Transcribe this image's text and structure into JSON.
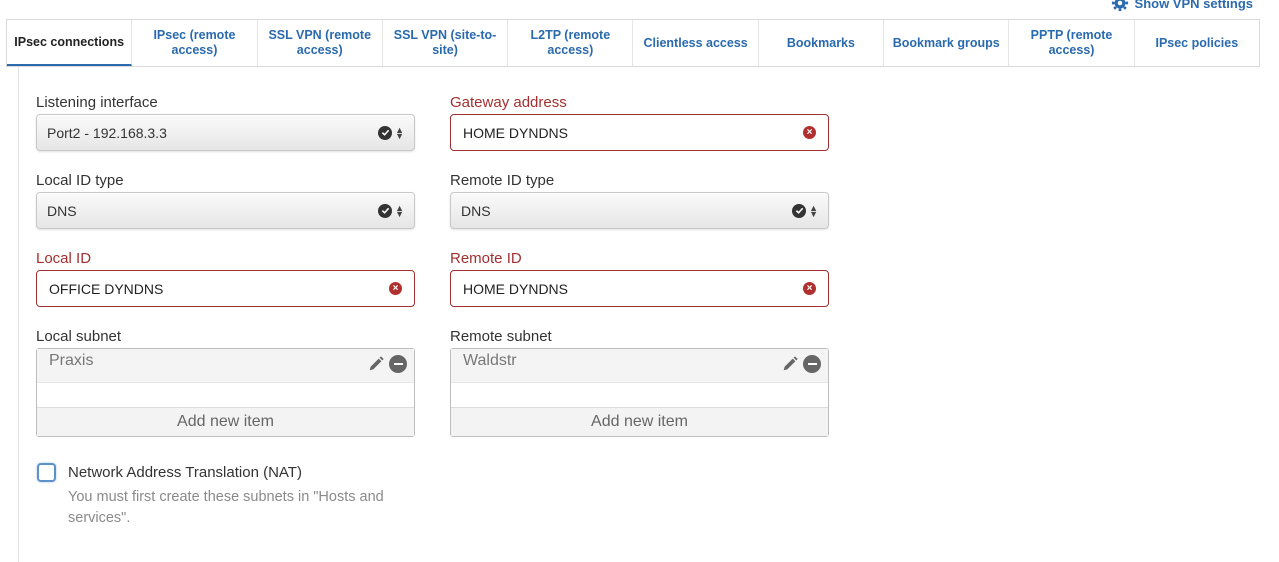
{
  "header": {
    "show_settings_label": "Show VPN settings"
  },
  "tabs": [
    {
      "label": "IPsec connections",
      "active": true
    },
    {
      "label": "IPsec (remote access)"
    },
    {
      "label": "SSL VPN (remote access)"
    },
    {
      "label": "SSL VPN (site-to-site)"
    },
    {
      "label": "L2TP (remote access)"
    },
    {
      "label": "Clientless access"
    },
    {
      "label": "Bookmarks"
    },
    {
      "label": "Bookmark groups"
    },
    {
      "label": "PPTP (remote access)"
    },
    {
      "label": "IPsec policies"
    }
  ],
  "form": {
    "listening_interface": {
      "label": "Listening interface",
      "value": "Port2 - 192.168.3.3"
    },
    "gateway_address": {
      "label": "Gateway address",
      "value": "HOME DYNDNS"
    },
    "local_id_type": {
      "label": "Local ID type",
      "value": "DNS"
    },
    "remote_id_type": {
      "label": "Remote ID type",
      "value": "DNS"
    },
    "local_id": {
      "label": "Local ID",
      "value": "OFFICE DYNDNS"
    },
    "remote_id": {
      "label": "Remote ID",
      "value": "HOME DYNDNS"
    },
    "local_subnet": {
      "label": "Local subnet",
      "items": [
        "Praxis"
      ],
      "add_label": "Add new item"
    },
    "remote_subnet": {
      "label": "Remote subnet",
      "items": [
        "Waldstr"
      ],
      "add_label": "Add new item"
    },
    "nat": {
      "label": "Network Address Translation (NAT)",
      "checked": false,
      "hint": "You must first create these subnets in \"Hosts and services\"."
    }
  },
  "colors": {
    "accent": "#2a6aad",
    "error": "#a33030"
  },
  "icons": [
    "gear-icon",
    "check-circle-icon",
    "updown-arrows-icon",
    "clear-icon",
    "pencil-icon",
    "remove-icon"
  ]
}
